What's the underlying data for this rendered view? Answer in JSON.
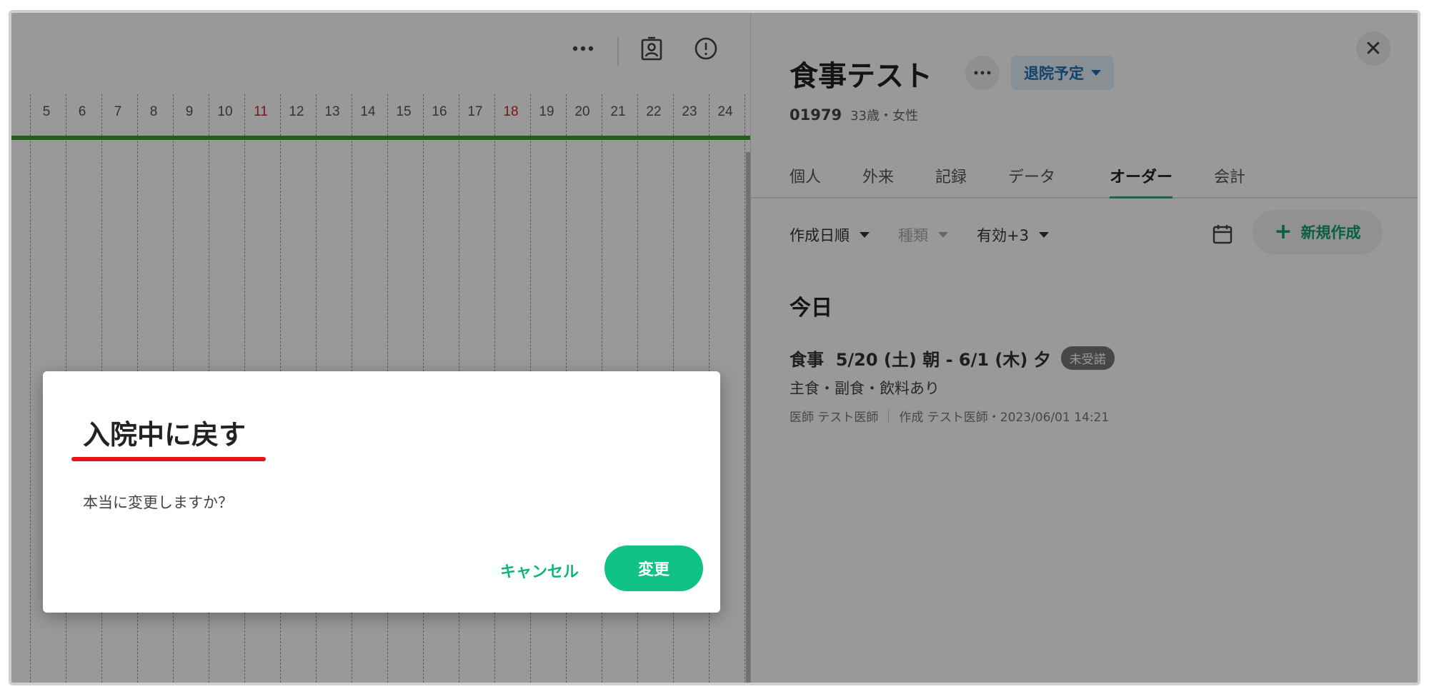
{
  "timeline": {
    "days": [
      "5",
      "6",
      "7",
      "8",
      "9",
      "10",
      "11",
      "12",
      "13",
      "14",
      "15",
      "16",
      "17",
      "18",
      "19",
      "20",
      "21",
      "22",
      "23",
      "24"
    ],
    "holidays": [
      "11",
      "18"
    ],
    "toolbar": {
      "more_icon": "more-horizontal-icon",
      "patient_card_icon": "patient-card-icon",
      "alert_icon": "alert-circle-icon"
    }
  },
  "patient": {
    "name": "食事テスト",
    "status": "退院予定",
    "id": "01979",
    "age_gender": "33歳・女性"
  },
  "tabs": [
    "個人",
    "外来",
    "記録",
    "データ",
    "オーダー",
    "会計"
  ],
  "active_tab": "オーダー",
  "filters": {
    "sort": "作成日順",
    "type": "種類",
    "valid": "有効+3"
  },
  "new_button": "新規作成",
  "section_today": "今日",
  "order": {
    "title": "食事  5/20 (土) 朝 - 6/1 (木) 夕",
    "badge": "未受諾",
    "detail": "主食・副食・飲料あり",
    "doctor": "医師 テスト医師",
    "created": "作成 テスト医師・2023/06/01 14:21"
  },
  "dialog": {
    "title": "入院中に戻す",
    "message": "本当に変更しますか？",
    "cancel": "キャンセル",
    "confirm": "変更"
  },
  "colors": {
    "accent": "#10c283",
    "status_chip_bg": "#e3f0fa",
    "status_chip_text": "#1f6fb2",
    "annotation_underline": "#e5141a",
    "timeline_bar": "#3c9a2e"
  }
}
